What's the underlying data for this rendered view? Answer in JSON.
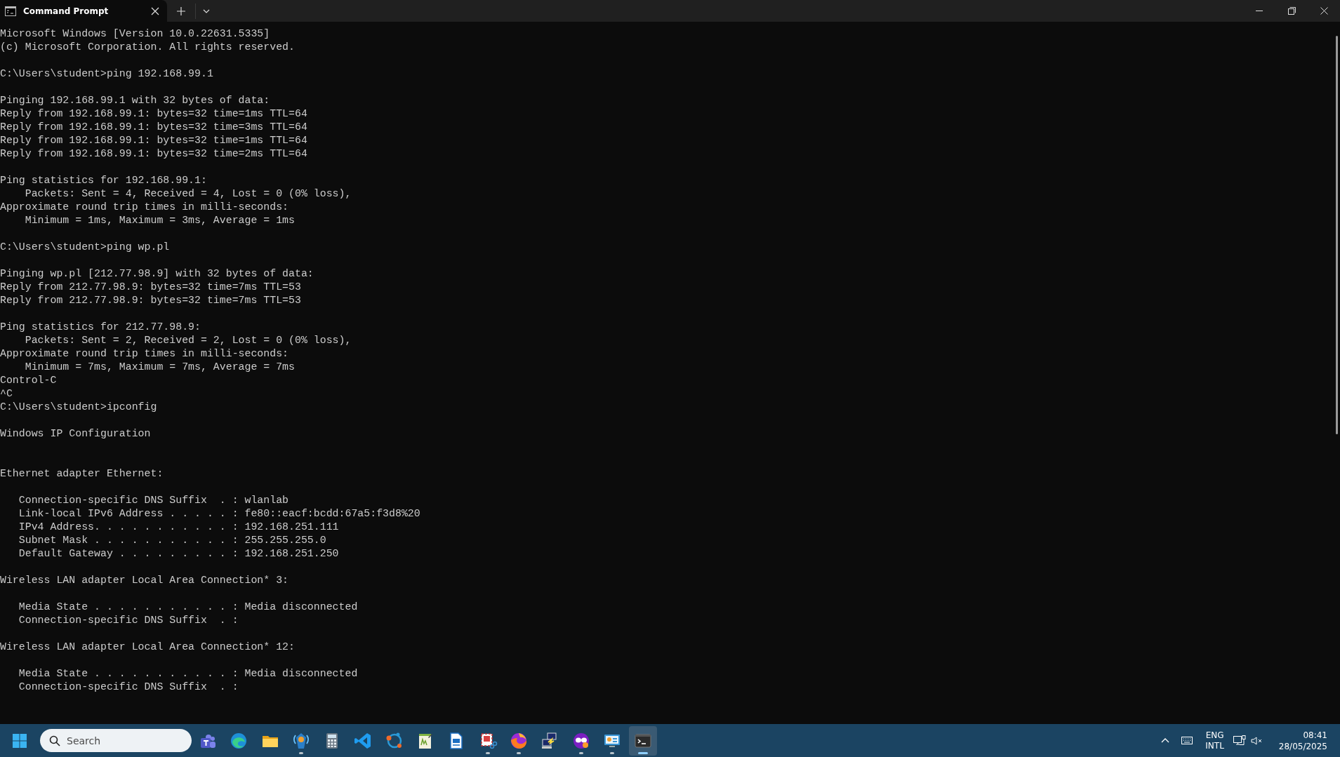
{
  "window": {
    "tab": {
      "title": "Command Prompt",
      "selected": true
    }
  },
  "terminal": {
    "blocks": [
      {
        "lines": [
          "Microsoft Windows [Version 10.0.22631.5335]",
          "(c) Microsoft Corporation. All rights reserved."
        ]
      },
      {
        "lines": [
          "C:\\Users\\student>ping 192.168.99.1"
        ]
      },
      {
        "lines": [
          "Pinging 192.168.99.1 with 32 bytes of data:",
          "Reply from 192.168.99.1: bytes=32 time=1ms TTL=64",
          "Reply from 192.168.99.1: bytes=32 time=3ms TTL=64",
          "Reply from 192.168.99.1: bytes=32 time=1ms TTL=64",
          "Reply from 192.168.99.1: bytes=32 time=2ms TTL=64"
        ]
      },
      {
        "lines": [
          "Ping statistics for 192.168.99.1:",
          "    Packets: Sent = 4, Received = 4, Lost = 0 (0% loss),",
          "Approximate round trip times in milli-seconds:",
          "    Minimum = 1ms, Maximum = 3ms, Average = 1ms"
        ]
      },
      {
        "lines": [
          "C:\\Users\\student>ping wp.pl"
        ]
      },
      {
        "lines": [
          "Pinging wp.pl [212.77.98.9] with 32 bytes of data:",
          "Reply from 212.77.98.9: bytes=32 time=7ms TTL=53",
          "Reply from 212.77.98.9: bytes=32 time=7ms TTL=53"
        ]
      },
      {
        "lines": [
          "Ping statistics for 212.77.98.9:",
          "    Packets: Sent = 2, Received = 2, Lost = 0 (0% loss),",
          "Approximate round trip times in milli-seconds:",
          "    Minimum = 7ms, Maximum = 7ms, Average = 7ms",
          "Control-C",
          "^C",
          "C:\\Users\\student>ipconfig"
        ]
      },
      {
        "lines": [
          "Windows IP Configuration"
        ]
      },
      {
        "extra_gap": true,
        "lines": [
          "Ethernet adapter Ethernet:"
        ]
      },
      {
        "lines": [
          "   Connection-specific DNS Suffix  . : wlanlab",
          "   Link-local IPv6 Address . . . . . : fe80::eacf:bcdd:67a5:f3d8%20",
          "   IPv4 Address. . . . . . . . . . . : 192.168.251.111",
          "   Subnet Mask . . . . . . . . . . . : 255.255.255.0",
          "   Default Gateway . . . . . . . . . : 192.168.251.250"
        ]
      },
      {
        "lines": [
          "Wireless LAN adapter Local Area Connection* 3:"
        ]
      },
      {
        "lines": [
          "   Media State . . . . . . . . . . . : Media disconnected",
          "   Connection-specific DNS Suffix  . :"
        ]
      },
      {
        "lines": [
          "Wireless LAN adapter Local Area Connection* 12:"
        ]
      },
      {
        "lines": [
          "   Media State . . . . . . . . . . . : Media disconnected",
          "   Connection-specific DNS Suffix  . :"
        ]
      }
    ]
  },
  "taskbar": {
    "search": {
      "placeholder": "Search"
    },
    "apps": [
      {
        "running": false,
        "selected": false
      },
      {
        "running": false,
        "selected": false
      },
      {
        "running": false,
        "selected": false
      },
      {
        "running": true,
        "selected": false
      },
      {
        "running": false,
        "selected": false
      },
      {
        "running": false,
        "selected": false
      },
      {
        "running": false,
        "selected": false
      },
      {
        "running": false,
        "selected": false
      },
      {
        "running": false,
        "selected": false
      },
      {
        "running": true,
        "selected": false
      },
      {
        "running": true,
        "selected": false
      },
      {
        "running": false,
        "selected": false
      },
      {
        "running": true,
        "selected": false
      },
      {
        "running": true,
        "selected": false
      },
      {
        "running": true,
        "selected": true
      }
    ],
    "tray": {
      "language": "ENG",
      "layout": "INTL",
      "time": "08:41",
      "date": "28/05/2025"
    }
  }
}
